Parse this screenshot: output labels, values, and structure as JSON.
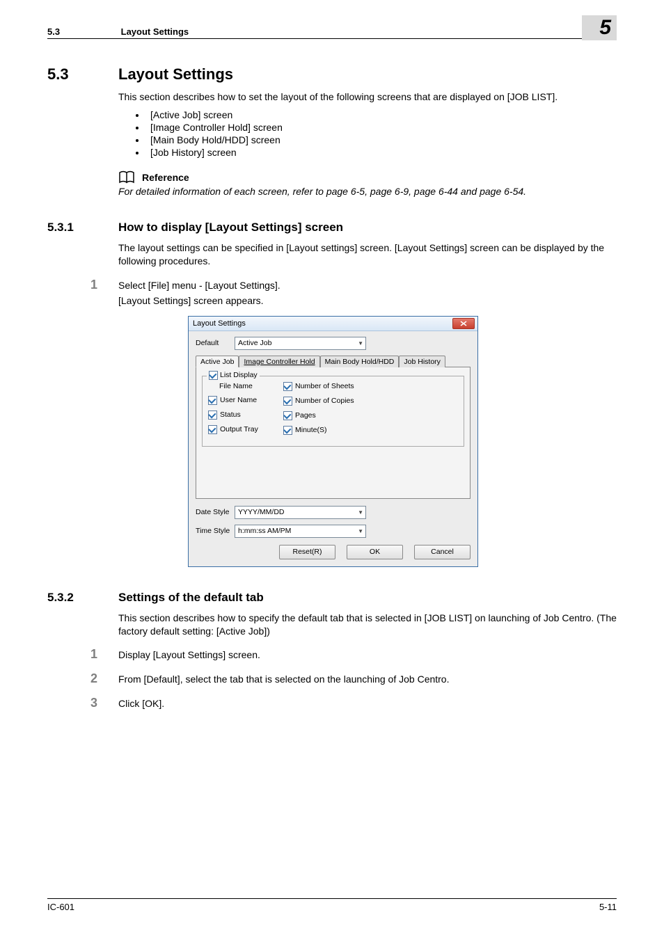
{
  "header": {
    "section_number": "5.3",
    "section_label": "Layout Settings",
    "chapter_number": "5"
  },
  "section_5_3": {
    "number": "5.3",
    "title": "Layout Settings",
    "intro": "This section describes how to set the layout of the following screens that are displayed on [JOB LIST].",
    "bullets": [
      "[Active Job] screen",
      "[Image Controller Hold] screen",
      "[Main Body Hold/HDD] screen",
      "[Job History] screen"
    ],
    "reference_label": "Reference",
    "reference_text": "For detailed information of each screen, refer to page 6-5, page 6-9, page 6-44 and page 6-54."
  },
  "section_5_3_1": {
    "number": "5.3.1",
    "title": "How to display [Layout Settings] screen",
    "intro": "The layout settings can be specified in [Layout settings] screen. [Layout Settings] screen can be displayed by the following procedures.",
    "step1_num": "1",
    "step1_text": "Select [File] menu - [Layout Settings].",
    "step1_sub": "[Layout Settings] screen appears."
  },
  "dialog": {
    "title": "Layout Settings",
    "default_label": "Default",
    "default_value": "Active Job",
    "tabs": {
      "active_job": "Active Job",
      "image_controller_hold": "Image Controller Hold",
      "main_body_hold": "Main Body Hold/HDD",
      "job_history": "Job History"
    },
    "list_display_legend": "List Display",
    "checks": {
      "file_name": "File Name",
      "user_name": "User Name",
      "status": "Status",
      "output_tray": "Output Tray",
      "number_of_sheets": "Number of Sheets",
      "number_of_copies": "Number of Copies",
      "pages": "Pages",
      "minutes": "Minute(S)"
    },
    "date_style_label": "Date Style",
    "date_style_value": "YYYY/MM/DD",
    "time_style_label": "Time Style",
    "time_style_value": "h:mm:ss AM/PM",
    "btn_reset": "Reset(R)",
    "btn_ok": "OK",
    "btn_cancel": "Cancel"
  },
  "section_5_3_2": {
    "number": "5.3.2",
    "title": "Settings of the default tab",
    "intro": "This section describes how to specify the default tab that is selected in [JOB LIST] on launching of Job Centro. (The factory default setting: [Active Job])",
    "step1_num": "1",
    "step1_text": "Display [Layout Settings] screen.",
    "step2_num": "2",
    "step2_text": "From [Default], select the tab that is selected on the launching of Job Centro.",
    "step3_num": "3",
    "step3_text": "Click [OK]."
  },
  "footer": {
    "left": "IC-601",
    "right": "5-11"
  }
}
